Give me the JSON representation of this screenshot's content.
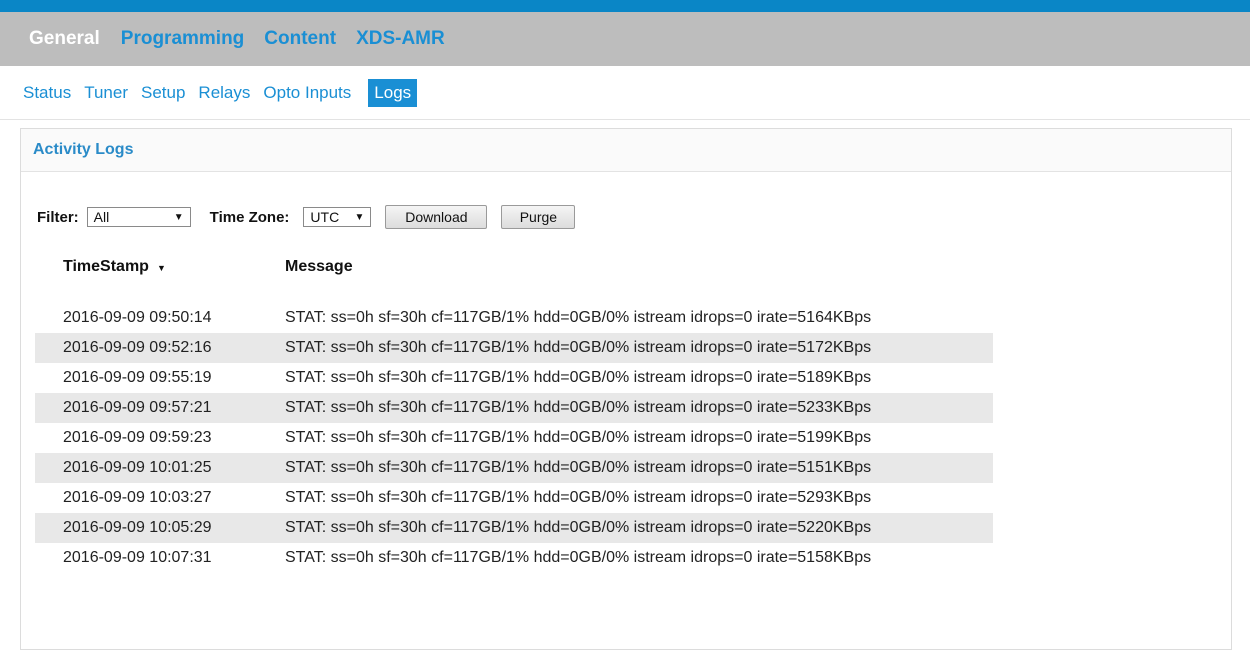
{
  "main_nav": [
    "General",
    "Programming",
    "Content",
    "XDS-AMR"
  ],
  "sub_nav": [
    "Status",
    "Tuner",
    "Setup",
    "Relays",
    "Opto Inputs",
    "Logs"
  ],
  "panel": {
    "title": "Activity Logs"
  },
  "controls": {
    "filter_label": "Filter:",
    "filter_value": "All",
    "timezone_label": "Time Zone:",
    "timezone_value": "UTC",
    "download_label": "Download",
    "purge_label": "Purge"
  },
  "table": {
    "col_timestamp": "TimeStamp",
    "col_message": "Message",
    "rows": [
      {
        "ts": "2016-09-09  09:50:14",
        "msg": "STAT: ss=0h sf=30h cf=117GB/1% hdd=0GB/0% istream idrops=0 irate=5164KBps"
      },
      {
        "ts": "2016-09-09  09:52:16",
        "msg": "STAT: ss=0h sf=30h cf=117GB/1% hdd=0GB/0% istream idrops=0 irate=5172KBps"
      },
      {
        "ts": "2016-09-09  09:55:19",
        "msg": "STAT: ss=0h sf=30h cf=117GB/1% hdd=0GB/0% istream idrops=0 irate=5189KBps"
      },
      {
        "ts": "2016-09-09  09:57:21",
        "msg": "STAT: ss=0h sf=30h cf=117GB/1% hdd=0GB/0% istream idrops=0 irate=5233KBps"
      },
      {
        "ts": "2016-09-09  09:59:23",
        "msg": "STAT: ss=0h sf=30h cf=117GB/1% hdd=0GB/0% istream idrops=0 irate=5199KBps"
      },
      {
        "ts": "2016-09-09  10:01:25",
        "msg": "STAT: ss=0h sf=30h cf=117GB/1% hdd=0GB/0% istream idrops=0 irate=5151KBps"
      },
      {
        "ts": "2016-09-09  10:03:27",
        "msg": "STAT: ss=0h sf=30h cf=117GB/1% hdd=0GB/0% istream idrops=0 irate=5293KBps"
      },
      {
        "ts": "2016-09-09  10:05:29",
        "msg": "STAT: ss=0h sf=30h cf=117GB/1% hdd=0GB/0% istream idrops=0 irate=5220KBps"
      },
      {
        "ts": "2016-09-09  10:07:31",
        "msg": "STAT: ss=0h sf=30h cf=117GB/1% hdd=0GB/0% istream idrops=0 irate=5158KBps"
      }
    ]
  },
  "colors": {
    "accent": "#1a8fd4",
    "top_strip": "#0a86c6",
    "nav_bg": "#bdbdbd",
    "row_alt": "#e8e8e8"
  }
}
